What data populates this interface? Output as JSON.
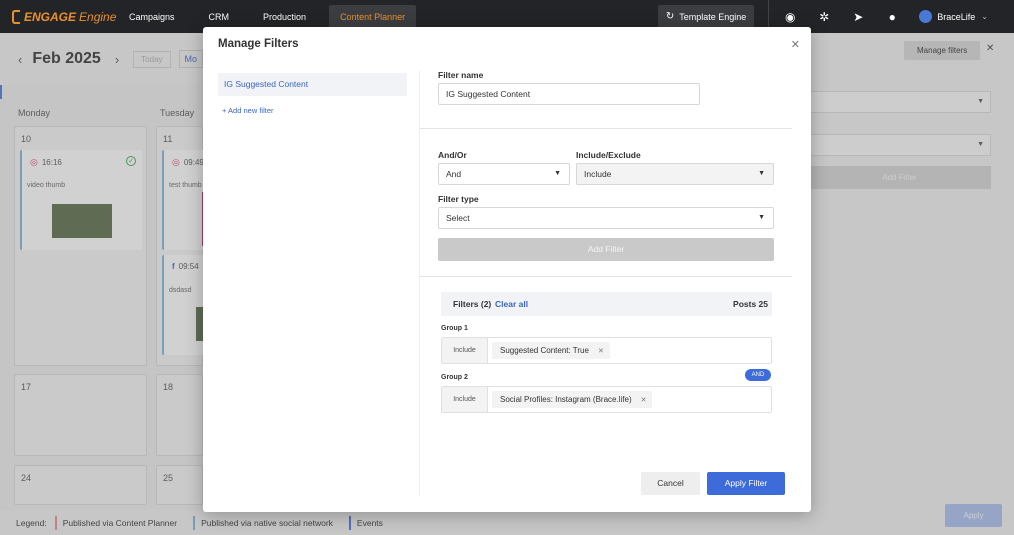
{
  "nav": {
    "logo_main": "ENGAGE",
    "logo_sub": "Engine",
    "items": [
      "Campaigns",
      "CRM",
      "Production",
      "Content Planner"
    ],
    "active_item": "Content Planner",
    "template_engine": "Template Engine",
    "user": "BraceLife",
    "accent": "#e8912d"
  },
  "calendar": {
    "month": "Feb 2025",
    "prev_arrow": "‹",
    "next_arrow": "›",
    "today_label": "Today",
    "view_label": "Mo",
    "days": [
      "Monday",
      "Tuesday"
    ],
    "dates": [
      "10",
      "11",
      "17",
      "18",
      "24",
      "25"
    ],
    "posts": [
      {
        "time": "16:16",
        "desc": "video thumb",
        "network": "instagram-icon"
      },
      {
        "time": "09:49",
        "desc": "test thumb",
        "network": "instagram-icon"
      },
      {
        "time": "09:54",
        "desc": "dsdasd",
        "network": "facebook-icon"
      }
    ]
  },
  "legend": {
    "label": "Legend:",
    "items": [
      {
        "text": "Published via Content Planner",
        "color": "#e08a8a"
      },
      {
        "text": "Published via native social network",
        "color": "#7fb0d4"
      },
      {
        "text": "Events",
        "color": "#4a6fd6"
      }
    ]
  },
  "right_panel": {
    "manage_filters_button": "Manage filters",
    "add_filter": "Add Filter",
    "apply": "Apply"
  },
  "modal": {
    "title": "Manage Filters",
    "saved_filters": [
      "IG Suggested Content"
    ],
    "add_new_filter": "+ Add new filter",
    "filter_name_label": "Filter name",
    "filter_name_value": "IG Suggested Content",
    "and_or_label": "And/Or",
    "and_or_value": "And",
    "include_exclude_label": "Include/Exclude",
    "include_exclude_value": "Include",
    "filter_type_label": "Filter type",
    "filter_type_value": "Select",
    "add_filter_button": "Add Filter",
    "filters_title": "Filters (2)",
    "clear_all": "Clear all",
    "posts_count": "Posts 25",
    "groups": [
      {
        "label": "Group 1",
        "mode": "Include",
        "chip": "Suggested Content: True"
      },
      {
        "label": "Group 2",
        "mode": "Include",
        "chip": "Social Profiles: Instagram (Brace.life)"
      }
    ],
    "and_badge": "AND",
    "cancel": "Cancel",
    "apply_filter": "Apply Filter",
    "primary_color": "#3d6bd9"
  }
}
